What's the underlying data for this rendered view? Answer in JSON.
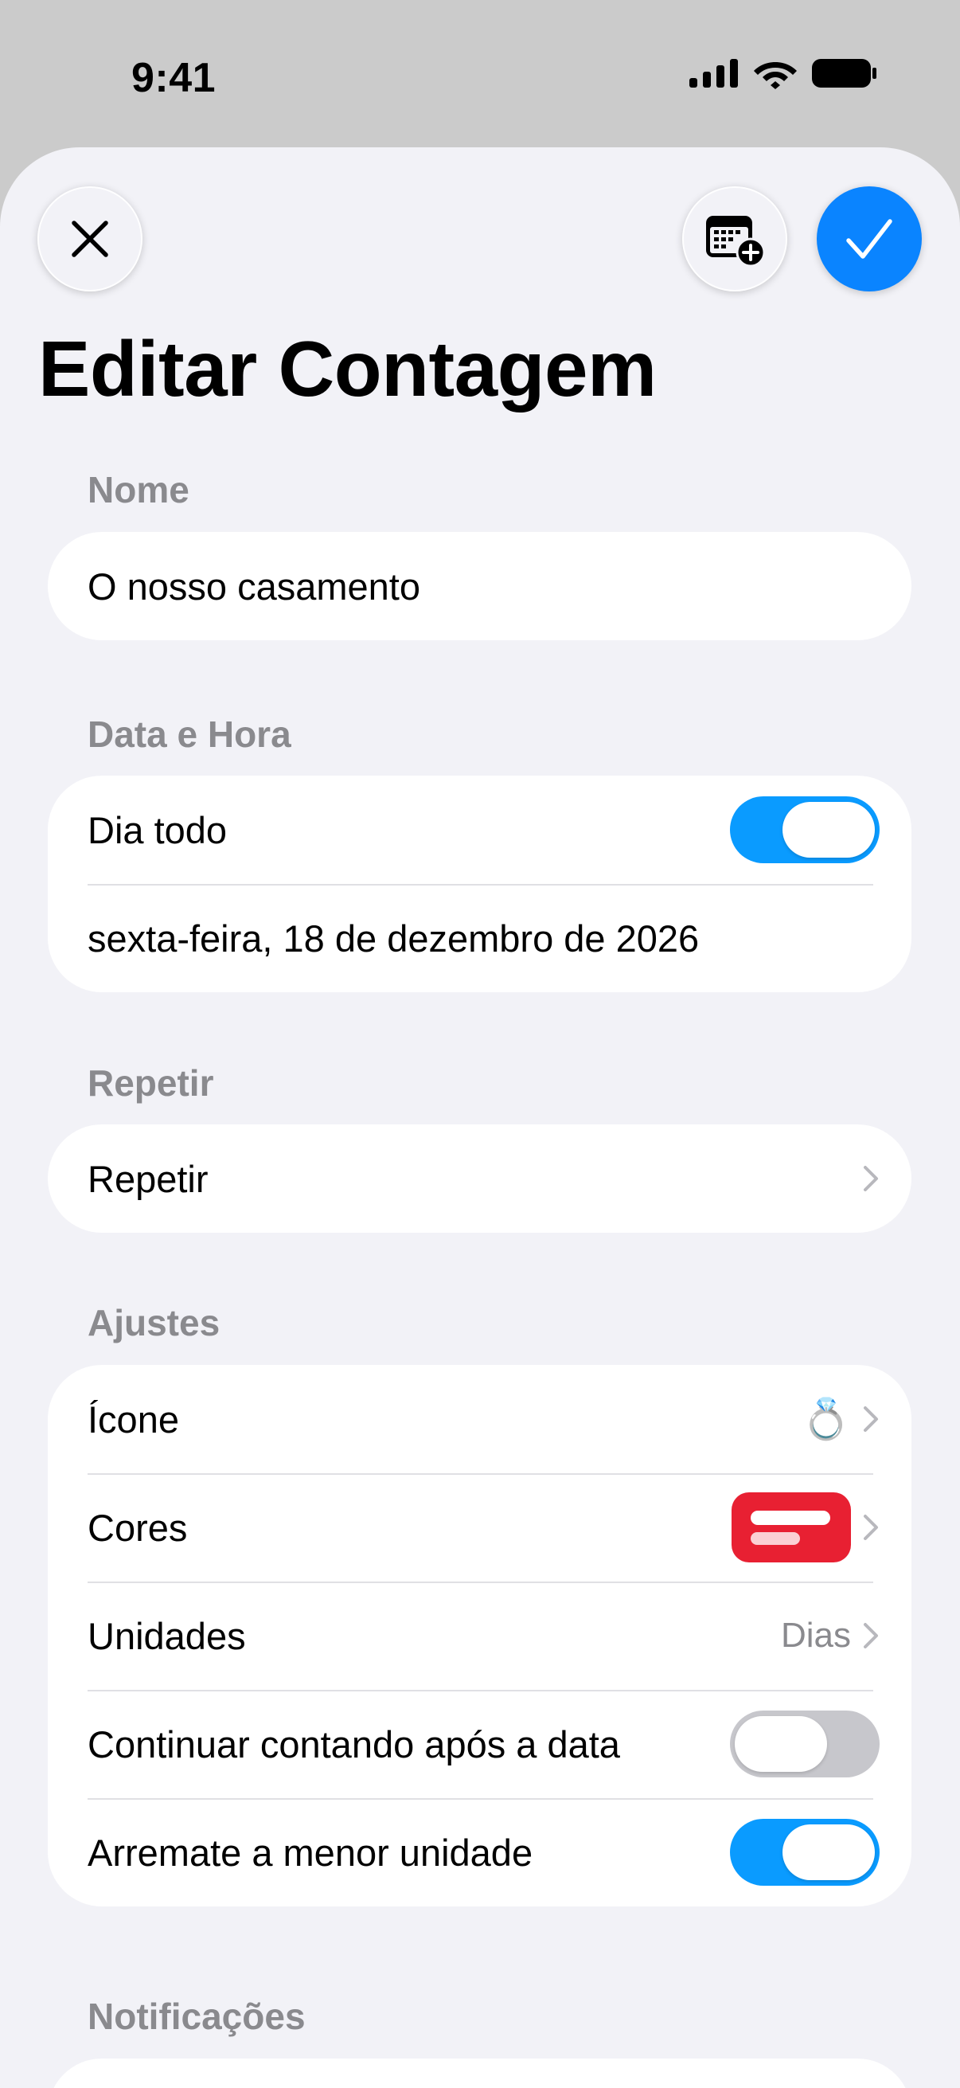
{
  "status_bar": {
    "time": "9:41"
  },
  "header": {
    "title": "Editar Contagem"
  },
  "sections": {
    "name": {
      "header": "Nome",
      "value": "O nosso casamento"
    },
    "datetime": {
      "header": "Data e Hora",
      "all_day_label": "Dia todo",
      "all_day_on": true,
      "date_value": "sexta-feira, 18 de dezembro de 2026"
    },
    "repeat": {
      "header": "Repetir",
      "row_label": "Repetir"
    },
    "settings": {
      "header": "Ajustes",
      "icon_label": "Ícone",
      "icon_value": "💍",
      "colors_label": "Cores",
      "colors_accent": "#e82032",
      "units_label": "Unidades",
      "units_value": "Dias",
      "continue_label": "Continuar contando após a data",
      "continue_on": false,
      "round_label": "Arremate a menor unidade",
      "round_on": true
    },
    "notifications": {
      "header": "Notificações"
    }
  },
  "colors": {
    "accent": "#0a84ff",
    "toggle_on": "#0a9bff",
    "background": "#f2f2f7"
  }
}
